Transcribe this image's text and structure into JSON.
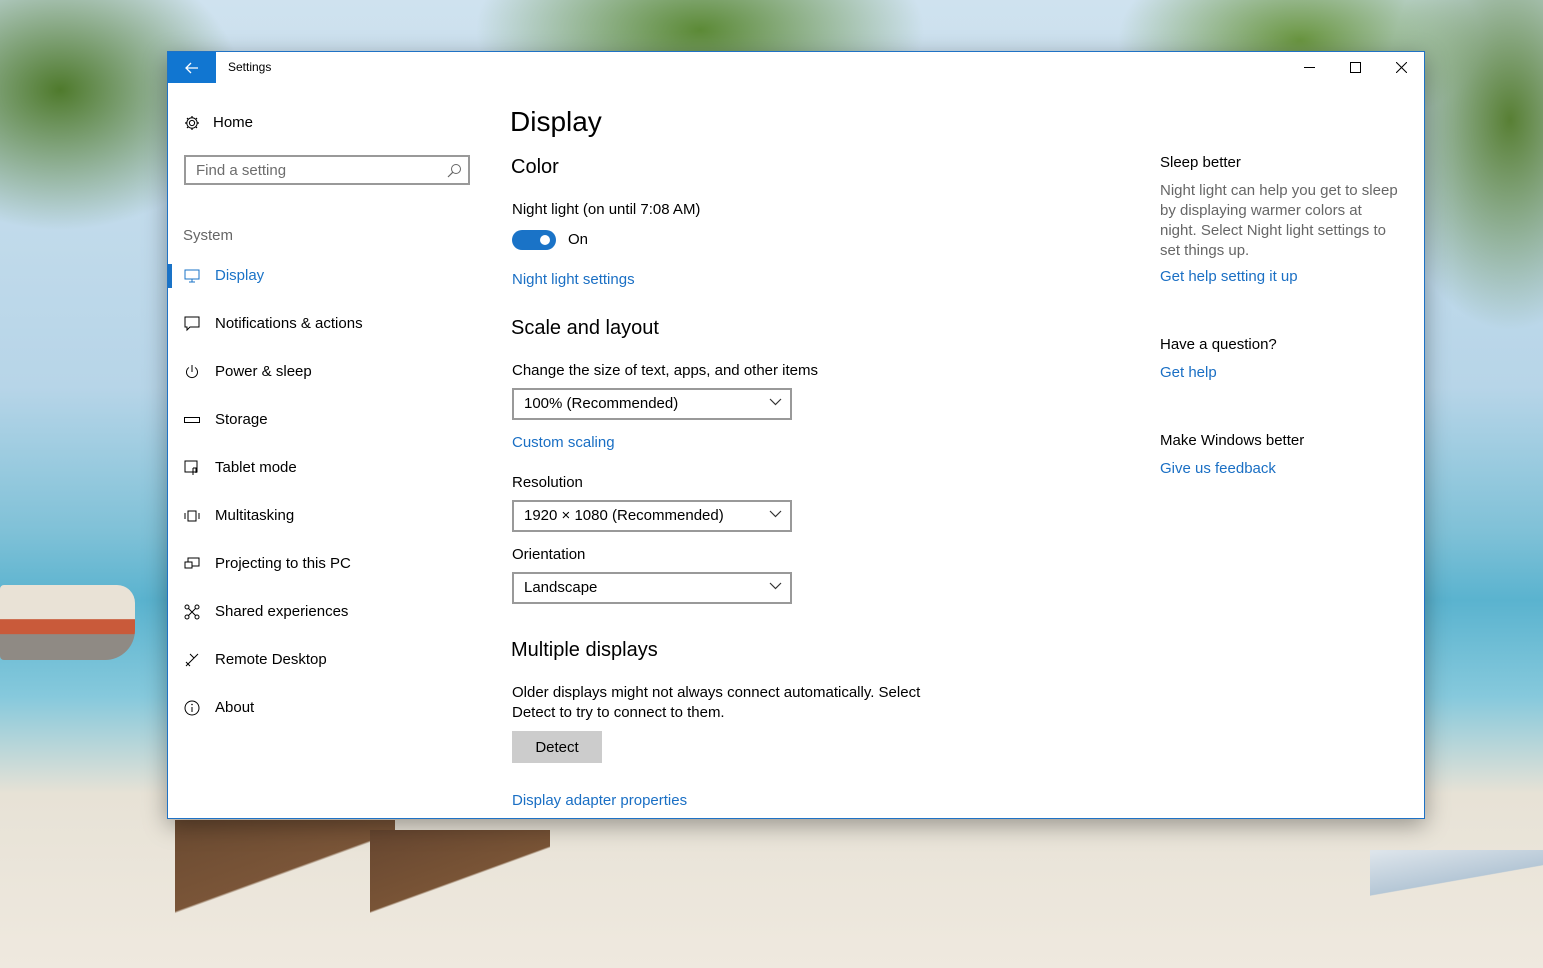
{
  "window": {
    "title": "Settings"
  },
  "sidebar": {
    "home_label": "Home",
    "search_placeholder": "Find a setting",
    "section_label": "System",
    "items": [
      {
        "label": "Display",
        "icon": "monitor-icon",
        "active": true
      },
      {
        "label": "Notifications & actions",
        "icon": "speech-bubble-icon"
      },
      {
        "label": "Power & sleep",
        "icon": "power-icon"
      },
      {
        "label": "Storage",
        "icon": "storage-icon"
      },
      {
        "label": "Tablet mode",
        "icon": "tablet-icon"
      },
      {
        "label": "Multitasking",
        "icon": "multitasking-icon"
      },
      {
        "label": "Projecting to this PC",
        "icon": "projecting-icon"
      },
      {
        "label": "Shared experiences",
        "icon": "shared-icon"
      },
      {
        "label": "Remote Desktop",
        "icon": "remote-desktop-icon"
      },
      {
        "label": "About",
        "icon": "info-icon"
      }
    ]
  },
  "main": {
    "title": "Display",
    "color": {
      "heading": "Color",
      "night_light_label": "Night light (on until 7:08 AM)",
      "toggle_state": "On",
      "night_light_settings_link": "Night light settings"
    },
    "scale": {
      "heading": "Scale and layout",
      "size_label": "Change the size of text, apps, and other items",
      "size_value": "100% (Recommended)",
      "custom_scaling_link": "Custom scaling",
      "resolution_label": "Resolution",
      "resolution_value": "1920 × 1080 (Recommended)",
      "orientation_label": "Orientation",
      "orientation_value": "Landscape"
    },
    "multiple": {
      "heading": "Multiple displays",
      "desc_line1": "Older displays might not always connect automatically. Select",
      "desc_line2": "Detect to try to connect to them.",
      "detect_button": "Detect",
      "adapter_link": "Display adapter properties"
    }
  },
  "aside": {
    "sleep_heading": "Sleep better",
    "sleep_desc": "Night light can help you get to sleep by displaying warmer colors at night. Select Night light settings to set things up.",
    "sleep_link": "Get help setting it up",
    "question_heading": "Have a question?",
    "question_link": "Get help",
    "feedback_heading": "Make Windows better",
    "feedback_link": "Give us feedback"
  },
  "colors": {
    "accent": "#1a73c7",
    "titlebar_back": "#1176d1",
    "link": "#1a6fc4"
  }
}
